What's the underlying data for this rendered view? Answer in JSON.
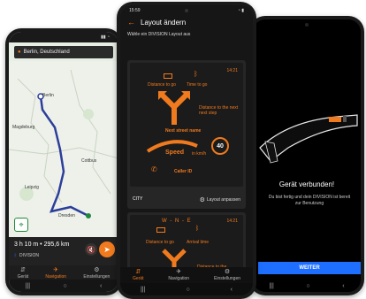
{
  "left": {
    "status_time": "",
    "search": "Berlin, Deutschland",
    "map_labels": [
      "Berlin",
      "Dresden",
      "Leipzig",
      "Cottbus",
      "Magdeburg"
    ],
    "summary": "3 h 10 m • 295,6 km",
    "brand": "DIVISION",
    "tabs": [
      "Gerät",
      "Navigation",
      "Einstellungen"
    ]
  },
  "mid": {
    "status_time": "15:59",
    "header_title": "Layout ändern",
    "subtitle": "Wähle ein DIVISION Layout aus",
    "card1": {
      "time": "14:21",
      "distance_to_go": "Distance to go",
      "time_to_go": "Time to go",
      "distance_next": "Distance to the next next step",
      "street": "Next street name",
      "speed": "Speed",
      "speed_unit": "in km/h",
      "limit": "40",
      "caller": "Caller ID",
      "name": "CITY",
      "adjust": "Layout anpassen"
    },
    "card2": {
      "time": "14:21",
      "compass": "W - N - E",
      "distance_to_go": "Distance to go",
      "arrival": "Arrival time",
      "distance_next": "Distance to the"
    },
    "tabs": [
      "Gerät",
      "Navigation",
      "Einstellungen"
    ]
  },
  "right": {
    "title": "Gerät verbunden!",
    "message": "Du bist fertig und dein DIVISION ist bereit zur Benutzung",
    "button": "WEITER"
  },
  "colors": {
    "accent": "#f07a1e",
    "blue": "#1e6fff",
    "route": "#2b3f9a"
  }
}
